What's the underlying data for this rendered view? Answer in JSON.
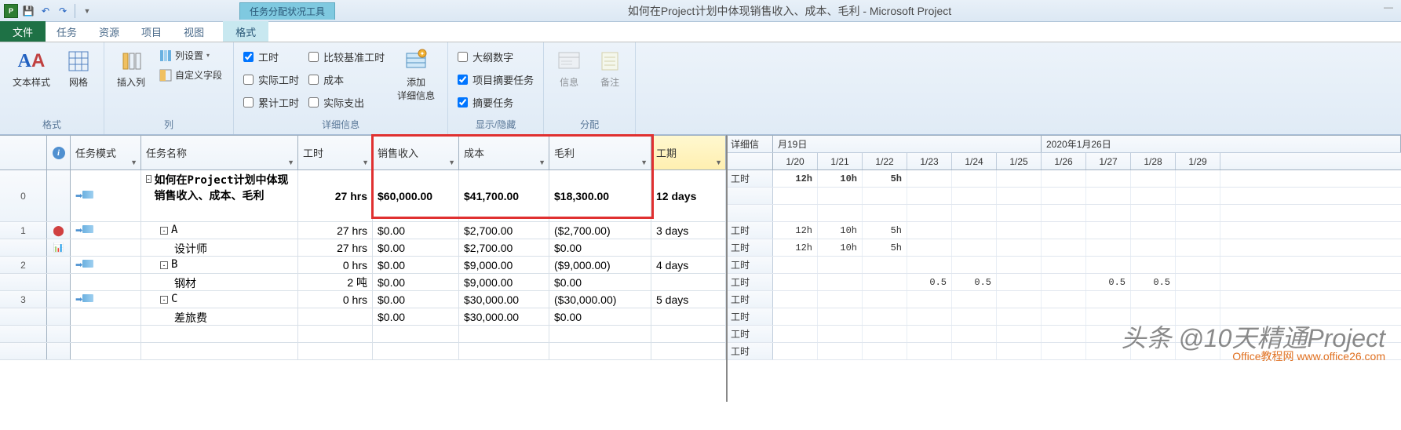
{
  "title": "如何在Project计划中体现销售收入、成本、毛利 - Microsoft Project",
  "context_tab": "任务分配状况工具",
  "tabs": {
    "file": "文件",
    "task": "任务",
    "resource": "资源",
    "project": "项目",
    "view": "视图",
    "format": "格式"
  },
  "ribbon": {
    "group_format": "格式",
    "group_columns": "列",
    "group_details": "详细信息",
    "group_showhide": "显示/隐藏",
    "group_assign": "分配",
    "text_styles": "文本样式",
    "gridlines": "网格",
    "insert_col": "插入列",
    "col_settings": "列设置",
    "custom_fields": "自定义字段",
    "work": "工时",
    "actual_work": "实际工时",
    "cumulative_work": "累计工时",
    "baseline_work": "比较基准工时",
    "cost": "成本",
    "actual_cost": "实际支出",
    "add_details": "添加\n详细信息",
    "outline_number": "大纲数字",
    "summary_tasks": "项目摘要任务",
    "summary": "摘要任务",
    "information": "信息",
    "notes": "备注"
  },
  "columns": {
    "indicator": "",
    "task_mode": "任务模式",
    "task_name": "任务名称",
    "work": "工时",
    "sales": "销售收入",
    "cost": "成本",
    "margin": "毛利",
    "duration": "工期",
    "details": "详细信"
  },
  "timescale": {
    "tier1_a": "月19日",
    "tier1_b": "2020年1月26日",
    "days": [
      "1/20",
      "1/21",
      "1/22",
      "1/23",
      "1/24",
      "1/25",
      "1/26",
      "1/27",
      "1/28",
      "1/29"
    ]
  },
  "rows": [
    {
      "id": "0",
      "indicator": "",
      "mode": "auto",
      "name": "如何在Project计划中体现销售收入、成本、毛利",
      "work": "27 hrs",
      "sales": "$60,000.00",
      "cost": "$41,700.00",
      "margin": "$18,300.00",
      "duration": "12 days",
      "bold": true,
      "tall": true,
      "outline": "-",
      "detail": "工时",
      "tp": [
        "12h",
        "10h",
        "5h",
        "",
        "",
        "",
        "",
        "",
        "",
        ""
      ]
    },
    {
      "id": "1",
      "indicator": "person",
      "mode": "auto",
      "name": "A",
      "work": "27 hrs",
      "sales": "$0.00",
      "cost": "$2,700.00",
      "margin": "($2,700.00)",
      "duration": "3 days",
      "outline": "-",
      "indent": 1,
      "detail": "工时",
      "tp": [
        "12h",
        "10h",
        "5h",
        "",
        "",
        "",
        "",
        "",
        "",
        ""
      ]
    },
    {
      "id": "",
      "indicator": "chart",
      "mode": "",
      "name": "设计师",
      "work": "27 hrs",
      "sales": "$0.00",
      "cost": "$2,700.00",
      "margin": "$0.00",
      "duration": "",
      "indent": 2,
      "detail": "工时",
      "tp": [
        "12h",
        "10h",
        "5h",
        "",
        "",
        "",
        "",
        "",
        "",
        ""
      ]
    },
    {
      "id": "2",
      "indicator": "",
      "mode": "auto",
      "name": "B",
      "work": "0 hrs",
      "sales": "$0.00",
      "cost": "$9,000.00",
      "margin": "($9,000.00)",
      "duration": "4 days",
      "outline": "-",
      "indent": 1,
      "detail": "工时",
      "tp": [
        "",
        "",
        "",
        "",
        "",
        "",
        "",
        "",
        "",
        ""
      ]
    },
    {
      "id": "",
      "indicator": "",
      "mode": "",
      "name": "钢材",
      "work": "2 吨",
      "sales": "$0.00",
      "cost": "$9,000.00",
      "margin": "$0.00",
      "duration": "",
      "indent": 2,
      "detail": "工时",
      "tp": [
        "",
        "",
        "",
        "0.5",
        "0.5",
        "",
        "",
        "0.5",
        "0.5",
        ""
      ]
    },
    {
      "id": "3",
      "indicator": "",
      "mode": "auto",
      "name": "C",
      "work": "0 hrs",
      "sales": "$0.00",
      "cost": "$30,000.00",
      "margin": "($30,000.00)",
      "duration": "5 days",
      "outline": "-",
      "indent": 1,
      "detail": "工时",
      "tp": [
        "",
        "",
        "",
        "",
        "",
        "",
        "",
        "",
        "",
        ""
      ]
    },
    {
      "id": "",
      "indicator": "",
      "mode": "",
      "name": "差旅费",
      "work": "",
      "sales": "$0.00",
      "cost": "$30,000.00",
      "margin": "$0.00",
      "duration": "",
      "indent": 2,
      "detail": "工时",
      "tp": [
        "",
        "",
        "",
        "",
        "",
        "",
        "",
        "",
        "",
        ""
      ]
    },
    {
      "id": "",
      "indicator": "",
      "mode": "",
      "name": "",
      "work": "",
      "sales": "",
      "cost": "",
      "margin": "",
      "duration": "",
      "detail": "工时",
      "tp": [
        "",
        "",
        "",
        "",
        "",
        "",
        "",
        "",
        "",
        ""
      ]
    },
    {
      "id": "",
      "indicator": "",
      "mode": "",
      "name": "",
      "work": "",
      "sales": "",
      "cost": "",
      "margin": "",
      "duration": "",
      "detail": "工时",
      "tp": [
        "",
        "",
        "",
        "",
        "",
        "",
        "",
        "",
        "",
        ""
      ]
    }
  ],
  "watermark": "头条 @10天精通Project",
  "watermark2": "Office教程网 www.office26.com"
}
